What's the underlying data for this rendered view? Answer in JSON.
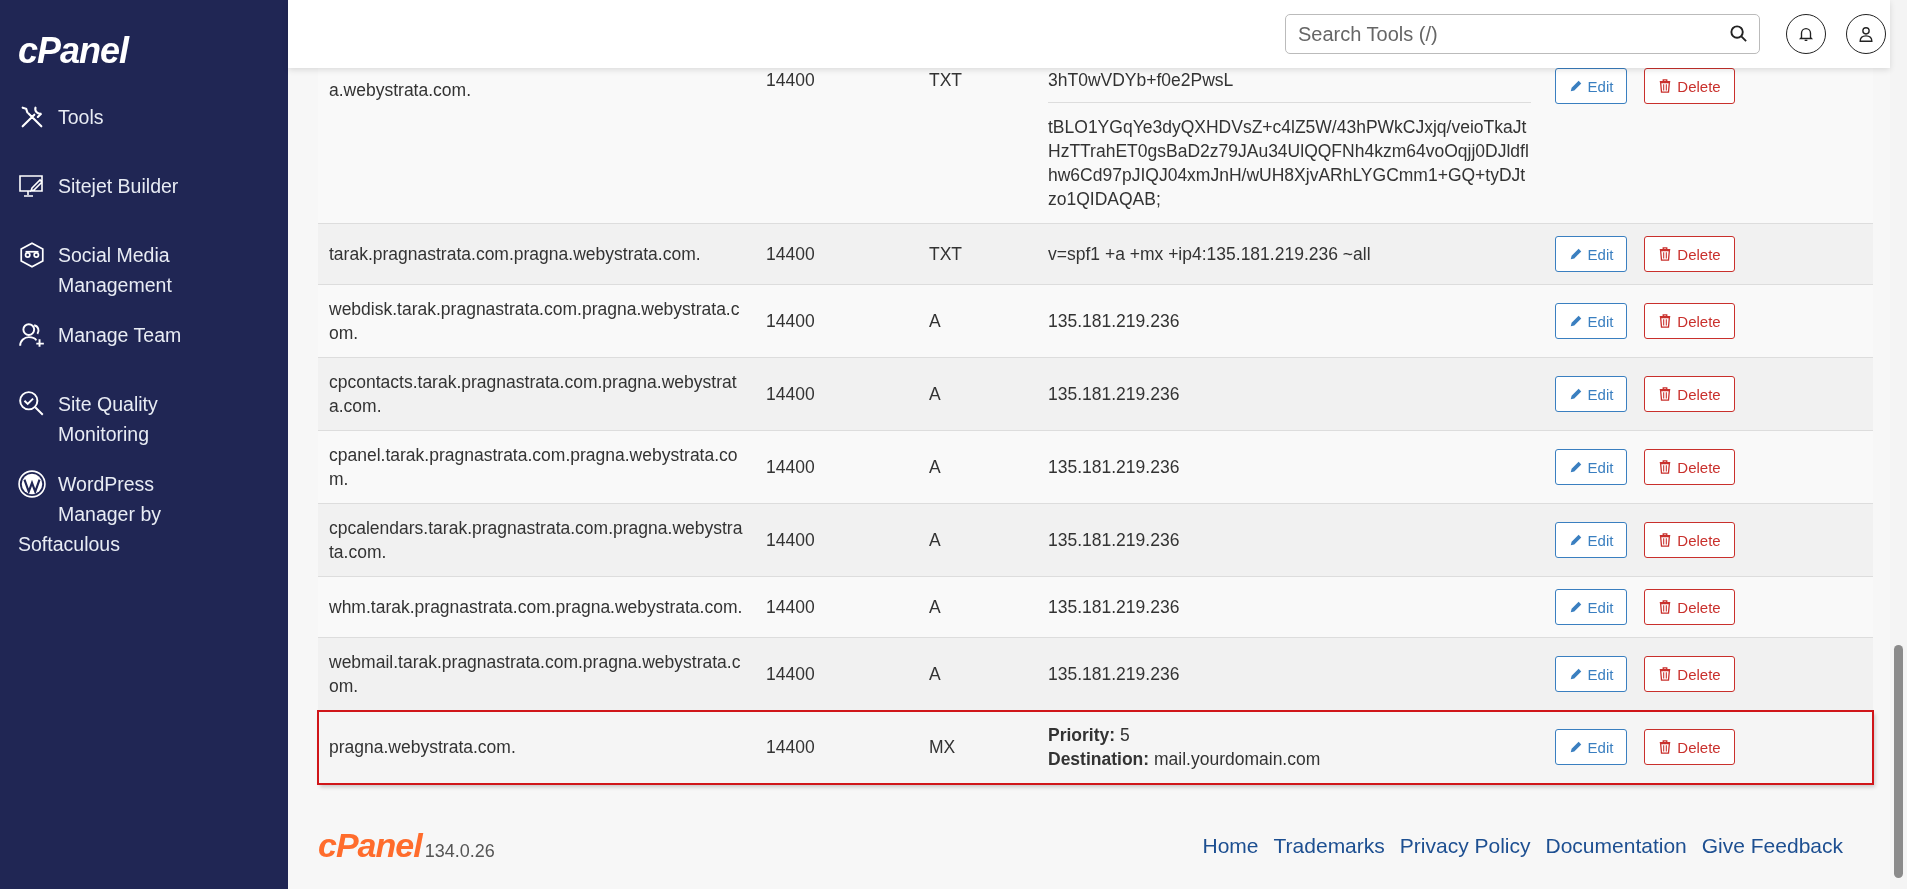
{
  "sidebar": {
    "logo": "cPanel",
    "items": [
      {
        "label": "Tools"
      },
      {
        "label": "Sitejet Builder"
      },
      {
        "label": "Social Media Management"
      },
      {
        "label": "Manage Team"
      },
      {
        "label": "Site Quality Monitoring"
      },
      {
        "label": "WordPress Manager by Softaculous"
      }
    ]
  },
  "header": {
    "search": {
      "placeholder": "Search Tools (/)"
    }
  },
  "records": [
    {
      "name": "a.webystrata.com.",
      "ttl": "14400",
      "type": "TXT",
      "record": {
        "kind": "parts",
        "parts": [
          "3hT0wVDYb+f0e2PwsL",
          "tBLO1YGqYe3dyQXHDVsZ+c4lZ5W/43hPWkCJxjq/veioTkaJtHzTTrahET0gsBaD2z79JAu34UlQQFNh4kzm64voOqjj0DJldflhw6Cd97pJIQJ04xmJnH/wUH8XjvARhLYGCmm1+GQ+tyDJtzo1QIDAQAB;"
        ]
      },
      "edit": "Edit",
      "delete": "Delete",
      "highlighted": false
    },
    {
      "name": "tarak.pragnastrata.com.pragna.webystrata.com.",
      "ttl": "14400",
      "type": "TXT",
      "record": {
        "kind": "parts",
        "parts": [
          "v=spf1 +a +mx +ip4:135.181.219.236 ~all"
        ]
      },
      "edit": "Edit",
      "delete": "Delete",
      "highlighted": false
    },
    {
      "name": "webdisk.tarak.pragnastrata.com.pragna.webystrata.com.",
      "ttl": "14400",
      "type": "A",
      "record": {
        "kind": "parts",
        "parts": [
          "135.181.219.236"
        ]
      },
      "edit": "Edit",
      "delete": "Delete",
      "highlighted": false
    },
    {
      "name": "cpcontacts.tarak.pragnastrata.com.pragna.webystrata.com.",
      "ttl": "14400",
      "type": "A",
      "record": {
        "kind": "parts",
        "parts": [
          "135.181.219.236"
        ]
      },
      "edit": "Edit",
      "delete": "Delete",
      "highlighted": false
    },
    {
      "name": "cpanel.tarak.pragnastrata.com.pragna.webystrata.com.",
      "ttl": "14400",
      "type": "A",
      "record": {
        "kind": "parts",
        "parts": [
          "135.181.219.236"
        ]
      },
      "edit": "Edit",
      "delete": "Delete",
      "highlighted": false
    },
    {
      "name": "cpcalendars.tarak.pragnastrata.com.pragna.webystrata.com.",
      "ttl": "14400",
      "type": "A",
      "record": {
        "kind": "parts",
        "parts": [
          "135.181.219.236"
        ]
      },
      "edit": "Edit",
      "delete": "Delete",
      "highlighted": false
    },
    {
      "name": "whm.tarak.pragnastrata.com.pragna.webystrata.com.",
      "ttl": "14400",
      "type": "A",
      "record": {
        "kind": "parts",
        "parts": [
          "135.181.219.236"
        ]
      },
      "edit": "Edit",
      "delete": "Delete",
      "highlighted": false
    },
    {
      "name": "webmail.tarak.pragnastrata.com.pragna.webystrata.com.",
      "ttl": "14400",
      "type": "A",
      "record": {
        "kind": "parts",
        "parts": [
          "135.181.219.236"
        ]
      },
      "edit": "Edit",
      "delete": "Delete",
      "highlighted": false
    },
    {
      "name": "pragna.webystrata.com.",
      "ttl": "14400",
      "type": "MX",
      "record": {
        "kind": "lines",
        "lines": [
          "**Priority:** 5",
          "**Destination:** mail.yourdomain.com"
        ]
      },
      "edit": "Edit",
      "delete": "Delete",
      "highlighted": true
    }
  ],
  "footer": {
    "logo": "cPanel",
    "version": "134.0.26",
    "links": [
      "Home",
      "Trademarks",
      "Privacy Policy",
      "Documentation",
      "Give Feedback"
    ]
  }
}
